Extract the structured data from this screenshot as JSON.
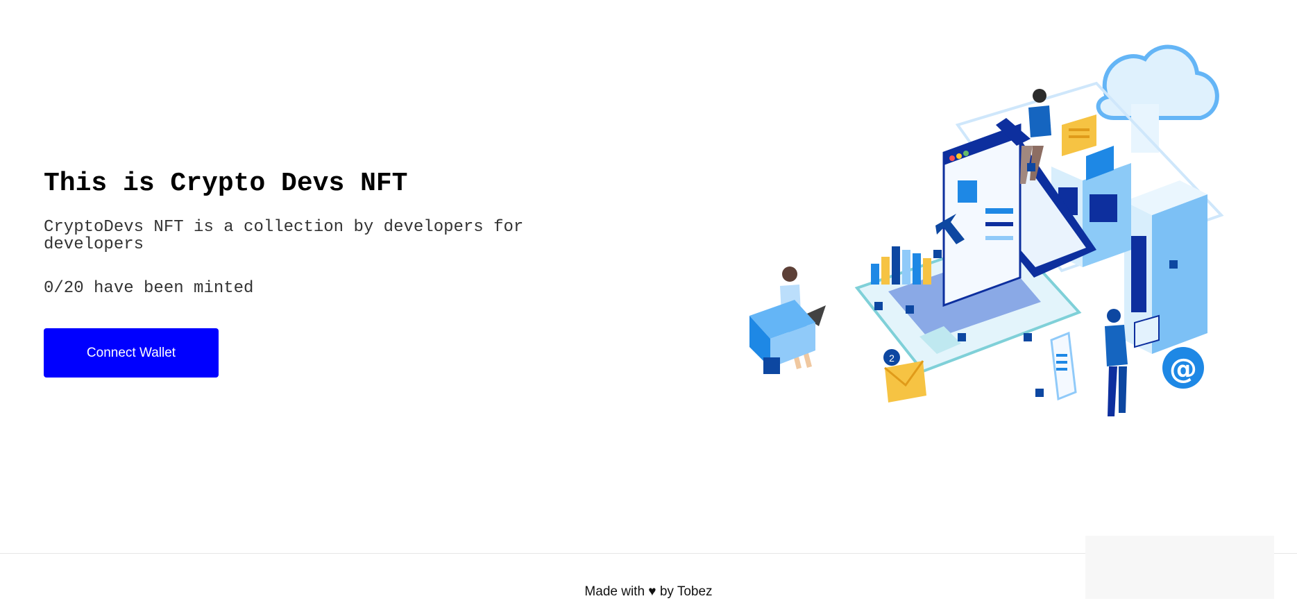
{
  "hero": {
    "title": "This is Crypto Devs NFT",
    "description": "CryptoDevs NFT is a collection by developers for developers",
    "mint_status": "0/20 have been minted",
    "connect_button_label": "Connect Wallet"
  },
  "illustration": {
    "icon": "isometric-developers-illustration",
    "badge_count": "2",
    "at_symbol": "@"
  },
  "footer": {
    "text": "Made with ♥ by Tobez"
  },
  "colors": {
    "primary_button": "#0000ff",
    "title_text": "#000000",
    "body_text": "#333333",
    "illustration_blue": "#1e88e5",
    "illustration_dark_blue": "#0d2f9e",
    "illustration_light_blue": "#bfe3fb",
    "illustration_yellow": "#f6c343"
  }
}
